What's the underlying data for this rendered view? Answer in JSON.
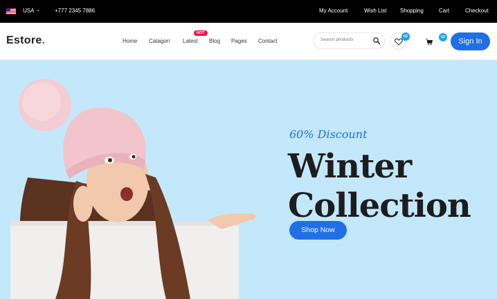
{
  "topbar": {
    "country": "USA",
    "phone": "+777 2345 7886",
    "links": [
      "My Account",
      "Wish List",
      "Shopping",
      "Cart",
      "Checkout"
    ]
  },
  "navbar": {
    "logo_text": "Estore",
    "logo_dot": ".",
    "menu": [
      "Home",
      "Catagori",
      "Latest",
      "Blog",
      "Pages",
      "Contact"
    ],
    "hot_badge": "HOT",
    "search_placeholder": "Search products",
    "wishlist_count": "02",
    "cart_count": "02",
    "signin_label": "Sign In"
  },
  "hero": {
    "discount": "60% Discount",
    "title_line1": "Winter",
    "title_line2": "Collection",
    "cta_label": "Shop Now"
  },
  "colors": {
    "accent": "#1f6fe5",
    "hero_bg": "#c3e8fc",
    "hot": "#e8174a",
    "badge": "#1aa3e8"
  },
  "icons": [
    "us-flag-icon",
    "chevron-down-icon",
    "search-icon",
    "heart-icon",
    "cart-icon"
  ]
}
